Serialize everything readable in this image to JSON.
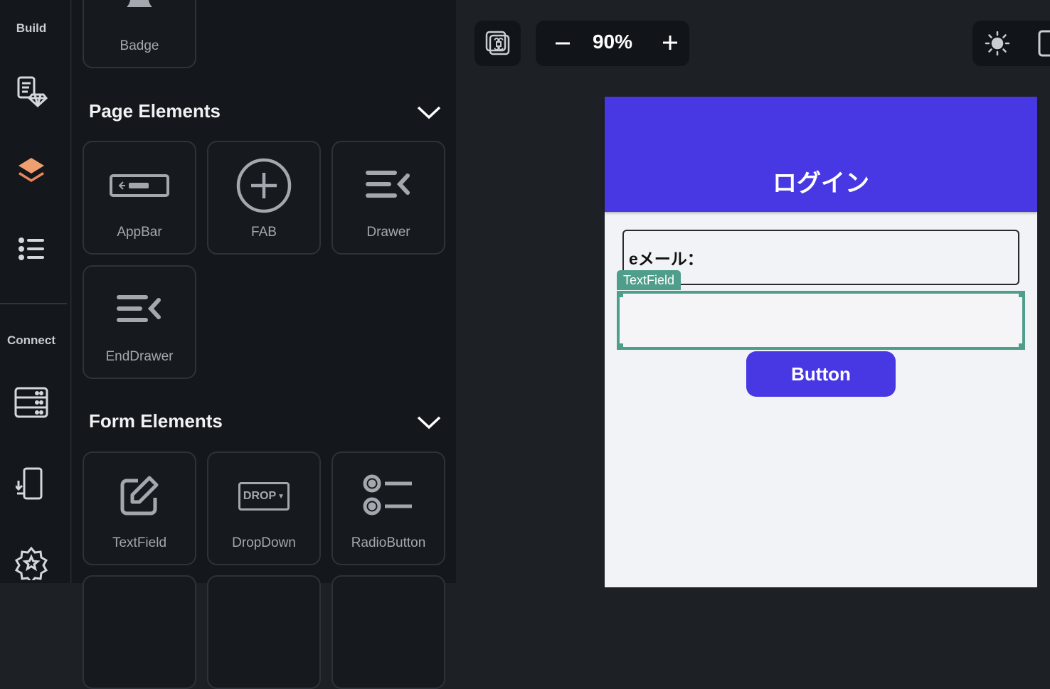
{
  "rail": {
    "build_label": "Build",
    "connect_label": "Connect",
    "items": [
      {
        "icon": "theme-gem-icon"
      },
      {
        "icon": "layers-icon",
        "active": true
      },
      {
        "icon": "list-icon"
      },
      {
        "icon": "database-icon"
      },
      {
        "icon": "mobile-download-icon"
      },
      {
        "icon": "gear-star-icon"
      }
    ]
  },
  "panel": {
    "top_partial": {
      "label": "Badge",
      "icon": "bell-icon"
    },
    "page_elements": {
      "title": "Page Elements",
      "items": [
        {
          "label": "AppBar",
          "icon": "appbar-icon"
        },
        {
          "label": "FAB",
          "icon": "plus-circle-icon"
        },
        {
          "label": "Drawer",
          "icon": "drawer-icon"
        },
        {
          "label": "EndDrawer",
          "icon": "end-drawer-icon"
        }
      ]
    },
    "form_elements": {
      "title": "Form Elements",
      "items": [
        {
          "label": "TextField",
          "icon": "edit-icon"
        },
        {
          "label": "DropDown",
          "icon": "dropdown-icon",
          "icon_text": "DROP"
        },
        {
          "label": "RadioButton",
          "icon": "radio-list-icon"
        }
      ]
    }
  },
  "toolbar": {
    "zoom": "90%",
    "zoom_out_icon": "minus-icon",
    "zoom_in_icon": "plus-icon"
  },
  "preview": {
    "appbar_title": "ログイン",
    "appbar_color": "#4838e4",
    "email_label": "eメール：",
    "selected_tag": "TextField",
    "selection_color": "#4f9e8b",
    "button_label": "Button"
  }
}
